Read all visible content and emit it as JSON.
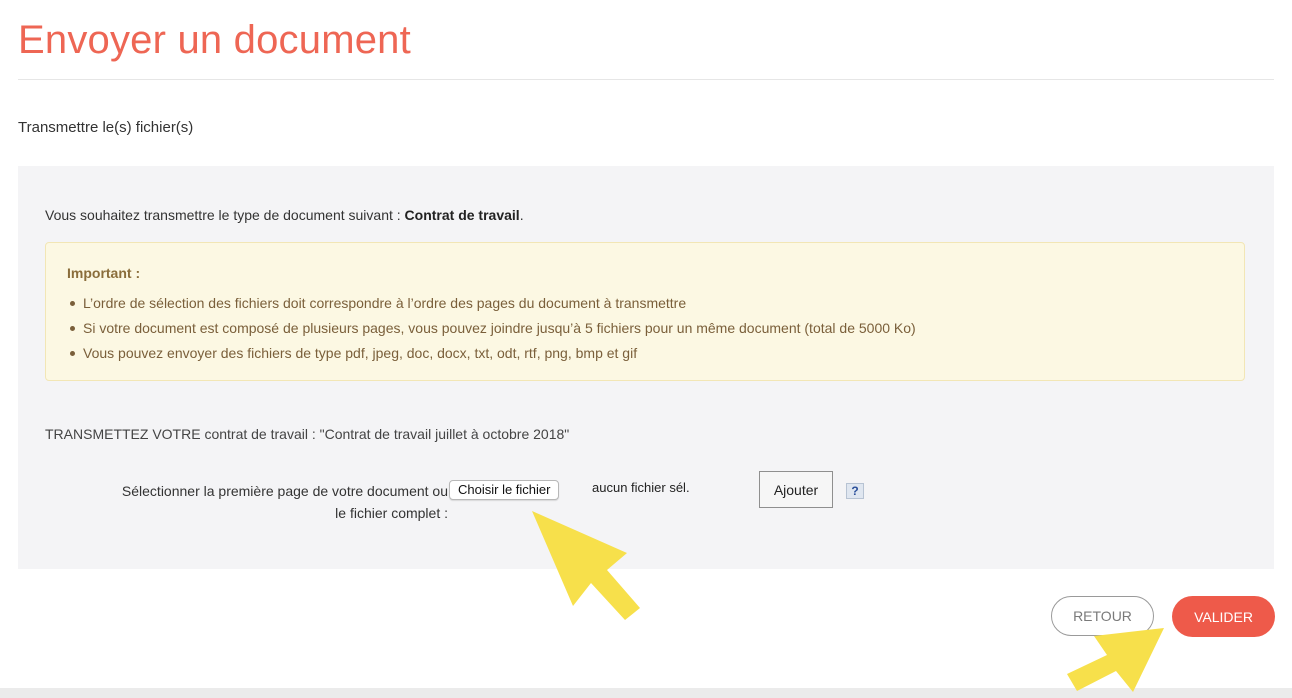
{
  "page": {
    "title": "Envoyer un document",
    "subtitle": "Transmettre le(s) fichier(s)"
  },
  "panel": {
    "intro_prefix": "Vous souhaitez transmettre le type de document suivant : ",
    "document_type": "Contrat de travail",
    "intro_suffix": ".",
    "notice": {
      "title": "Important :",
      "items": [
        "L’ordre de sélection des fichiers doit correspondre à l’ordre des pages du document à transmettre",
        "Si votre document est composé de plusieurs pages, vous pouvez joindre jusqu’à 5 fichiers pour un même document (total de 5000 Ko)",
        "Vous pouvez envoyer des fichiers de type pdf, jpeg, doc, docx, txt, odt, rtf, png, bmp et gif"
      ]
    },
    "transmit_line": "TRANSMETTEZ VOTRE contrat de travail : \"Contrat de travail juillet à octobre 2018\"",
    "upload": {
      "label_line1": "Sélectionner la première page de votre document ou",
      "label_line2": "le fichier complet  :",
      "choose_button": "Choisir le fichier",
      "file_status": "aucun fichier sél.",
      "add_button": "Ajouter",
      "help_symbol": "?"
    }
  },
  "actions": {
    "back_label": "RETOUR",
    "submit_label": "VALIDER"
  },
  "colors": {
    "accent": "#ee6654",
    "submit": "#ee5a4a",
    "panel_bg": "#f4f4f6",
    "notice_bg": "#fcf8e3",
    "annotation_arrow": "#f7e04b"
  },
  "icons": {
    "help": "question-mark-icon",
    "annotation": "arrow-annotation"
  }
}
